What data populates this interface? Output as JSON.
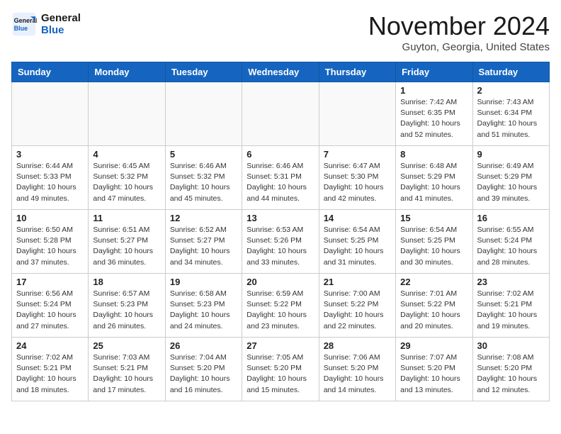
{
  "header": {
    "logo_line1": "General",
    "logo_line2": "Blue",
    "month_title": "November 2024",
    "location": "Guyton, Georgia, United States"
  },
  "weekdays": [
    "Sunday",
    "Monday",
    "Tuesday",
    "Wednesday",
    "Thursday",
    "Friday",
    "Saturday"
  ],
  "weeks": [
    [
      {
        "day": "",
        "info": ""
      },
      {
        "day": "",
        "info": ""
      },
      {
        "day": "",
        "info": ""
      },
      {
        "day": "",
        "info": ""
      },
      {
        "day": "",
        "info": ""
      },
      {
        "day": "1",
        "info": "Sunrise: 7:42 AM\nSunset: 6:35 PM\nDaylight: 10 hours\nand 52 minutes."
      },
      {
        "day": "2",
        "info": "Sunrise: 7:43 AM\nSunset: 6:34 PM\nDaylight: 10 hours\nand 51 minutes."
      }
    ],
    [
      {
        "day": "3",
        "info": "Sunrise: 6:44 AM\nSunset: 5:33 PM\nDaylight: 10 hours\nand 49 minutes."
      },
      {
        "day": "4",
        "info": "Sunrise: 6:45 AM\nSunset: 5:32 PM\nDaylight: 10 hours\nand 47 minutes."
      },
      {
        "day": "5",
        "info": "Sunrise: 6:46 AM\nSunset: 5:32 PM\nDaylight: 10 hours\nand 45 minutes."
      },
      {
        "day": "6",
        "info": "Sunrise: 6:46 AM\nSunset: 5:31 PM\nDaylight: 10 hours\nand 44 minutes."
      },
      {
        "day": "7",
        "info": "Sunrise: 6:47 AM\nSunset: 5:30 PM\nDaylight: 10 hours\nand 42 minutes."
      },
      {
        "day": "8",
        "info": "Sunrise: 6:48 AM\nSunset: 5:29 PM\nDaylight: 10 hours\nand 41 minutes."
      },
      {
        "day": "9",
        "info": "Sunrise: 6:49 AM\nSunset: 5:29 PM\nDaylight: 10 hours\nand 39 minutes."
      }
    ],
    [
      {
        "day": "10",
        "info": "Sunrise: 6:50 AM\nSunset: 5:28 PM\nDaylight: 10 hours\nand 37 minutes."
      },
      {
        "day": "11",
        "info": "Sunrise: 6:51 AM\nSunset: 5:27 PM\nDaylight: 10 hours\nand 36 minutes."
      },
      {
        "day": "12",
        "info": "Sunrise: 6:52 AM\nSunset: 5:27 PM\nDaylight: 10 hours\nand 34 minutes."
      },
      {
        "day": "13",
        "info": "Sunrise: 6:53 AM\nSunset: 5:26 PM\nDaylight: 10 hours\nand 33 minutes."
      },
      {
        "day": "14",
        "info": "Sunrise: 6:54 AM\nSunset: 5:25 PM\nDaylight: 10 hours\nand 31 minutes."
      },
      {
        "day": "15",
        "info": "Sunrise: 6:54 AM\nSunset: 5:25 PM\nDaylight: 10 hours\nand 30 minutes."
      },
      {
        "day": "16",
        "info": "Sunrise: 6:55 AM\nSunset: 5:24 PM\nDaylight: 10 hours\nand 28 minutes."
      }
    ],
    [
      {
        "day": "17",
        "info": "Sunrise: 6:56 AM\nSunset: 5:24 PM\nDaylight: 10 hours\nand 27 minutes."
      },
      {
        "day": "18",
        "info": "Sunrise: 6:57 AM\nSunset: 5:23 PM\nDaylight: 10 hours\nand 26 minutes."
      },
      {
        "day": "19",
        "info": "Sunrise: 6:58 AM\nSunset: 5:23 PM\nDaylight: 10 hours\nand 24 minutes."
      },
      {
        "day": "20",
        "info": "Sunrise: 6:59 AM\nSunset: 5:22 PM\nDaylight: 10 hours\nand 23 minutes."
      },
      {
        "day": "21",
        "info": "Sunrise: 7:00 AM\nSunset: 5:22 PM\nDaylight: 10 hours\nand 22 minutes."
      },
      {
        "day": "22",
        "info": "Sunrise: 7:01 AM\nSunset: 5:22 PM\nDaylight: 10 hours\nand 20 minutes."
      },
      {
        "day": "23",
        "info": "Sunrise: 7:02 AM\nSunset: 5:21 PM\nDaylight: 10 hours\nand 19 minutes."
      }
    ],
    [
      {
        "day": "24",
        "info": "Sunrise: 7:02 AM\nSunset: 5:21 PM\nDaylight: 10 hours\nand 18 minutes."
      },
      {
        "day": "25",
        "info": "Sunrise: 7:03 AM\nSunset: 5:21 PM\nDaylight: 10 hours\nand 17 minutes."
      },
      {
        "day": "26",
        "info": "Sunrise: 7:04 AM\nSunset: 5:20 PM\nDaylight: 10 hours\nand 16 minutes."
      },
      {
        "day": "27",
        "info": "Sunrise: 7:05 AM\nSunset: 5:20 PM\nDaylight: 10 hours\nand 15 minutes."
      },
      {
        "day": "28",
        "info": "Sunrise: 7:06 AM\nSunset: 5:20 PM\nDaylight: 10 hours\nand 14 minutes."
      },
      {
        "day": "29",
        "info": "Sunrise: 7:07 AM\nSunset: 5:20 PM\nDaylight: 10 hours\nand 13 minutes."
      },
      {
        "day": "30",
        "info": "Sunrise: 7:08 AM\nSunset: 5:20 PM\nDaylight: 10 hours\nand 12 minutes."
      }
    ]
  ]
}
